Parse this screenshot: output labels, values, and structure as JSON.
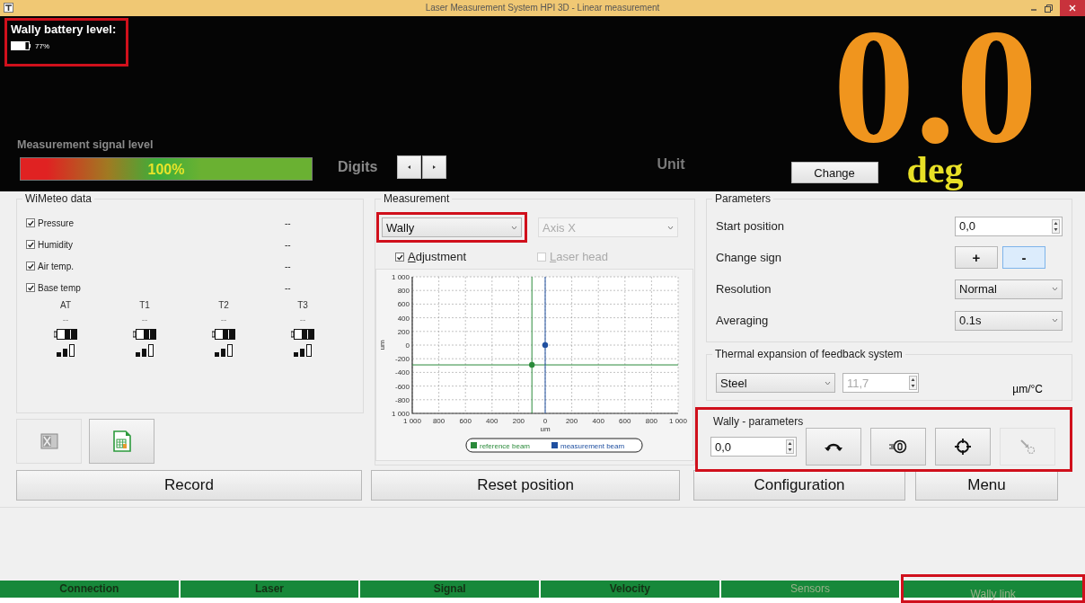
{
  "window": {
    "title": "Laser Measurement System HPI 3D - Linear measurement"
  },
  "battery": {
    "label": "Wally battery level:",
    "level": 0.77,
    "reading": "77%",
    "highlighted": true
  },
  "signal": {
    "label": "Measurement signal level",
    "level": 1.0,
    "reading": "100%"
  },
  "digits": {
    "label": "Digits"
  },
  "display": {
    "unit_label": "Unit",
    "change_button": "Change",
    "value": "0.0",
    "unit": "deg"
  },
  "wimeteo": {
    "title": "WiMeteo data",
    "readings": [
      {
        "label": "Pressure",
        "checked": true,
        "value": "--"
      },
      {
        "label": "Humidity",
        "checked": true,
        "value": "--"
      },
      {
        "label": "Air temp.",
        "checked": true,
        "value": "--"
      },
      {
        "label": "Base temp",
        "checked": true,
        "value": "--"
      }
    ],
    "sensors": [
      {
        "label": "AT",
        "value": "--"
      },
      {
        "label": "T1",
        "value": "--"
      },
      {
        "label": "T2",
        "value": "--"
      },
      {
        "label": "T3",
        "value": "--"
      }
    ]
  },
  "export_buttons": [
    {
      "kind": "grey-sheet",
      "disabled": true
    },
    {
      "kind": "green-sheet",
      "disabled": false
    }
  ],
  "measurement": {
    "title": "Measurement",
    "mode": {
      "value": "Wally",
      "highlighted": true
    },
    "axis": {
      "value": "Axis X",
      "disabled": true
    },
    "options": [
      {
        "label": "Adjustment",
        "checked": true,
        "disabled": false
      },
      {
        "label": "Laser head",
        "checked": false,
        "disabled": true
      }
    ],
    "chart_data": {
      "type": "scatter",
      "grid": true,
      "legend": "bottom",
      "xlabel": "um",
      "ylabel": "um",
      "xlim": [
        -1000,
        1000
      ],
      "ylim": [
        -1000,
        1000
      ],
      "xticks": [
        {
          "value": -1000,
          "label": "1 000"
        },
        {
          "value": -800,
          "label": "800"
        },
        {
          "value": -600,
          "label": "600"
        },
        {
          "value": -400,
          "label": "400"
        },
        {
          "value": -200,
          "label": "200"
        },
        0,
        200,
        400,
        600,
        800,
        {
          "value": 1000,
          "label": "1 000"
        }
      ],
      "yticks": [
        {
          "value": -1000,
          "label": "1 000"
        },
        -800,
        -600,
        -400,
        -200,
        0,
        200,
        400,
        600,
        800,
        {
          "value": 1000,
          "label": "1 000"
        }
      ],
      "series": [
        {
          "name": "reference beam",
          "color": "#2a8a3a",
          "x": [
            -100
          ],
          "values": [
            -290
          ]
        },
        {
          "name": "measurement beam",
          "color": "#2050a0",
          "x": [
            0
          ],
          "values": [
            0
          ]
        }
      ],
      "ref_lines": [
        {
          "axis": "x",
          "value": -100,
          "color": "#2a8a3a"
        },
        {
          "axis": "y",
          "value": -290,
          "color": "#2a8a3a"
        },
        {
          "axis": "x",
          "value": 0,
          "color": "#2050a0"
        }
      ]
    }
  },
  "parameters": {
    "title": "Parameters",
    "rows": [
      {
        "kind": "spin",
        "label": "Start position",
        "value": "0,0"
      },
      {
        "kind": "sign",
        "label": "Change sign",
        "options": [
          {
            "label": "+",
            "selected": false
          },
          {
            "label": "-",
            "selected": true
          }
        ]
      },
      {
        "kind": "select",
        "label": "Resolution",
        "value": "Normal"
      },
      {
        "kind": "select",
        "label": "Averaging",
        "value": "0.1s"
      }
    ]
  },
  "thermal": {
    "title": "Thermal expansion of feedback system",
    "material": "Steel",
    "coefficient": "11,7",
    "coefficient_disabled": true,
    "unit": "µm/°C"
  },
  "wally_parameters": {
    "title": "Wally - parameters",
    "value": "0,0",
    "highlighted": true,
    "tools": [
      {
        "kind": "rotate",
        "disabled": false
      },
      {
        "kind": "zero",
        "disabled": false
      },
      {
        "kind": "target",
        "disabled": false
      },
      {
        "kind": "probe",
        "disabled": true
      }
    ]
  },
  "actions": [
    "Record",
    "Reset position",
    "Configuration",
    "Menu"
  ],
  "status_bar": [
    {
      "label": "Connection",
      "dimmed": false,
      "highlighted": false
    },
    {
      "label": "Laser",
      "dimmed": false,
      "highlighted": false
    },
    {
      "label": "Signal",
      "dimmed": false,
      "highlighted": false
    },
    {
      "label": "Velocity",
      "dimmed": false,
      "highlighted": false
    },
    {
      "label": "Sensors",
      "dimmed": true,
      "highlighted": false
    },
    {
      "label": "Wally link",
      "dimmed": true,
      "highlighted": true
    }
  ]
}
